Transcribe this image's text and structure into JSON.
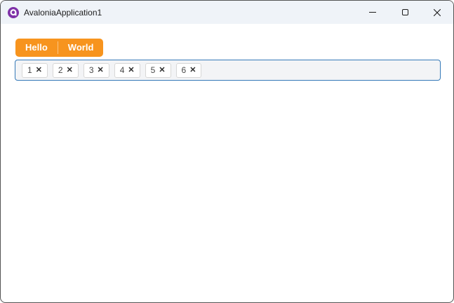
{
  "theme": {
    "accent": "#F7941E",
    "focus-border": "#3579B8",
    "titlebar-bg": "#EFF3F8",
    "input-bg": "#F3F4F6",
    "chip-bg": "#FFFFFF",
    "chip-border": "#D7D7D7"
  },
  "window": {
    "title": "AvaloniaApplication1",
    "app_icon": "avalonia-logo",
    "caption_buttons": [
      {
        "name": "minimize",
        "icon": "minimize-icon"
      },
      {
        "name": "maximize",
        "icon": "maximize-icon"
      },
      {
        "name": "close",
        "icon": "close-icon"
      }
    ]
  },
  "toolbar": {
    "buttons": [
      {
        "label": "Hello"
      },
      {
        "label": "World"
      }
    ]
  },
  "tag_input": {
    "remove_icon": "✕",
    "chips": [
      {
        "label": "1"
      },
      {
        "label": "2"
      },
      {
        "label": "3"
      },
      {
        "label": "4"
      },
      {
        "label": "5"
      },
      {
        "label": "6"
      }
    ]
  }
}
